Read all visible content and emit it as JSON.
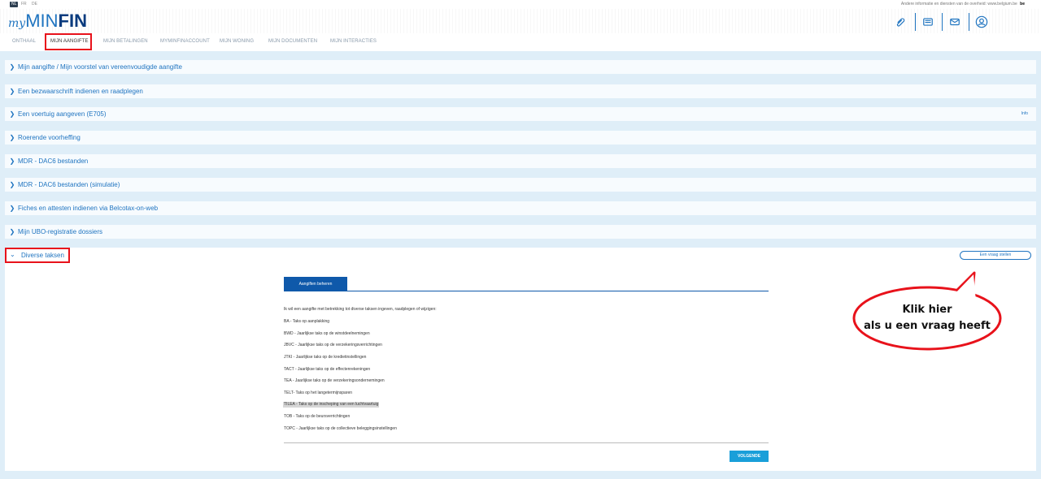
{
  "top": {
    "languages": [
      "NL",
      "FR",
      "DE"
    ],
    "info_text": "Andere informatie en diensten van de overheid: www.belgium.be",
    "be_badge": "be"
  },
  "header": {
    "logo_my": "my",
    "logo_min": "MIN",
    "logo_fin": "FIN",
    "icons": [
      "paperclip-icon",
      "document-list-icon",
      "mail-icon",
      "user-icon"
    ]
  },
  "nav": {
    "items": [
      "ONTHAAL",
      "MIJN AANGIFTE",
      "MIJN BETALINGEN",
      "MYMINFINACCOUNT",
      "MIJN WONING",
      "MIJN DOCUMENTEN",
      "MIJN INTERACTIES"
    ],
    "active_index": 1
  },
  "accordion": [
    {
      "label": "Mijn aangifte / Mijn voorstel van vereenvoudigde aangifte"
    },
    {
      "label": "Een bezwaarschrift indienen en raadplegen"
    },
    {
      "label": "Een voertuig aangeven (E705)",
      "info": "Info"
    },
    {
      "label": "Roerende voorheffing"
    },
    {
      "label": "MDR - DAC6 bestanden"
    },
    {
      "label": "MDR - DAC6 bestanden (simulatie)"
    },
    {
      "label": "Fiches en attesten indienen via Belcotax-on-web"
    },
    {
      "label": "Mijn UBO-registratie dossiers"
    }
  ],
  "open_section": {
    "label": "Diverse taksen",
    "ask_button": "Een vraag stellen",
    "tab": "Aangiften beheren",
    "intro": "Ik wil een aangifte met betrekking tot diverse taksen ingeven, raadplegen of wijzigen:",
    "taxes": [
      "BA - Taks op aanplakking",
      "BWD - Jaarlijkse taks op de winstdeelnemingen",
      "JBVC - Jaarlijkse taks op de verzekeringsverrichtingen",
      "JTKI - Jaarlijkse taks op de kredietinstellingen",
      "TACT - Jaarlijkse taks op de effectenrekeningen",
      "TEA - Jaarlijkse taks op de verzekeringsondernemingen",
      "TELT- Taks op het langetermijnsparen",
      "TILEA - Taks op de inscheping van een luchtvaartuig",
      "TOB - Taks op de beursverrichtingen",
      "TOPC - Jaarlijkse taks op de collectieve beleggingsinstellingen"
    ],
    "highlighted_index": 7,
    "next_button": "VOLGENDE"
  },
  "callout": {
    "line1": "Klik hier",
    "line2": "als u een vraag heeft"
  },
  "colors": {
    "brand_blue": "#1f74c0",
    "dark_blue": "#0a3b7e",
    "annotation_red": "#e8121b",
    "next_button": "#1a9fd9"
  }
}
